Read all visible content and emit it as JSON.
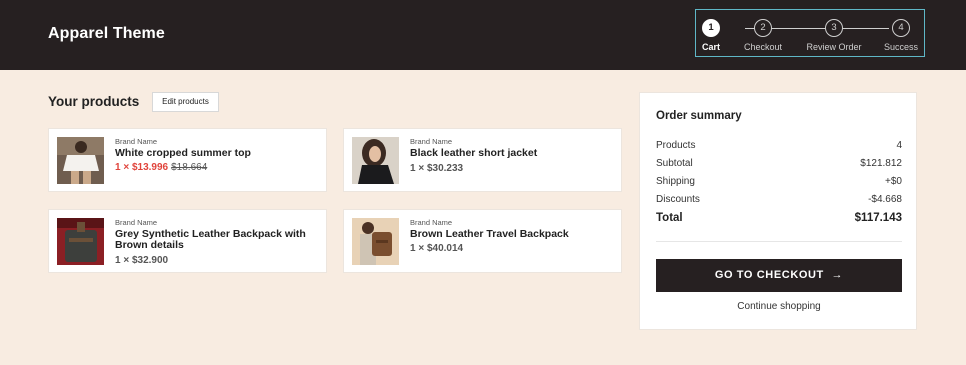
{
  "header": {
    "brand": "Apparel Theme"
  },
  "stepper": {
    "steps": [
      {
        "number": "1",
        "label": "Cart",
        "active": true
      },
      {
        "number": "2",
        "label": "Checkout",
        "active": false
      },
      {
        "number": "3",
        "label": "Review Order",
        "active": false
      },
      {
        "number": "4",
        "label": "Success",
        "active": false
      }
    ]
  },
  "products": {
    "title": "Your products",
    "edit_label": "Edit products",
    "items": [
      {
        "brand": "Brand Name",
        "name": "White cropped summer top",
        "quantity_prefix": "1 ×",
        "price": "$13.996",
        "old_price": "$18.664"
      },
      {
        "brand": "Brand Name",
        "name": "Black leather short jacket",
        "price_line": "1 × $30.233"
      },
      {
        "brand": "Brand Name",
        "name": "Grey Synthetic Leather Backpack with Brown details",
        "price_line": "1 × $32.900"
      },
      {
        "brand": "Brand Name",
        "name": "Brown Leather Travel Backpack",
        "price_line": "1 × $40.014"
      }
    ]
  },
  "summary": {
    "title": "Order summary",
    "rows": [
      {
        "label": "Products",
        "value": "4"
      },
      {
        "label": "Subtotal",
        "value": "$121.812"
      },
      {
        "label": "Shipping",
        "value": "+$0"
      },
      {
        "label": "Discounts",
        "value": "-$4.668"
      }
    ],
    "total": {
      "label": "Total",
      "value": "$117.143"
    },
    "checkout_label": "GO TO CHECKOUT",
    "checkout_arrow": "→",
    "continue_label": "Continue shopping"
  },
  "colors": {
    "header_bg": "#262021",
    "page_bg": "#f8ece1",
    "sale": "#e0443c",
    "stepper_outline": "#5fb7c7"
  }
}
